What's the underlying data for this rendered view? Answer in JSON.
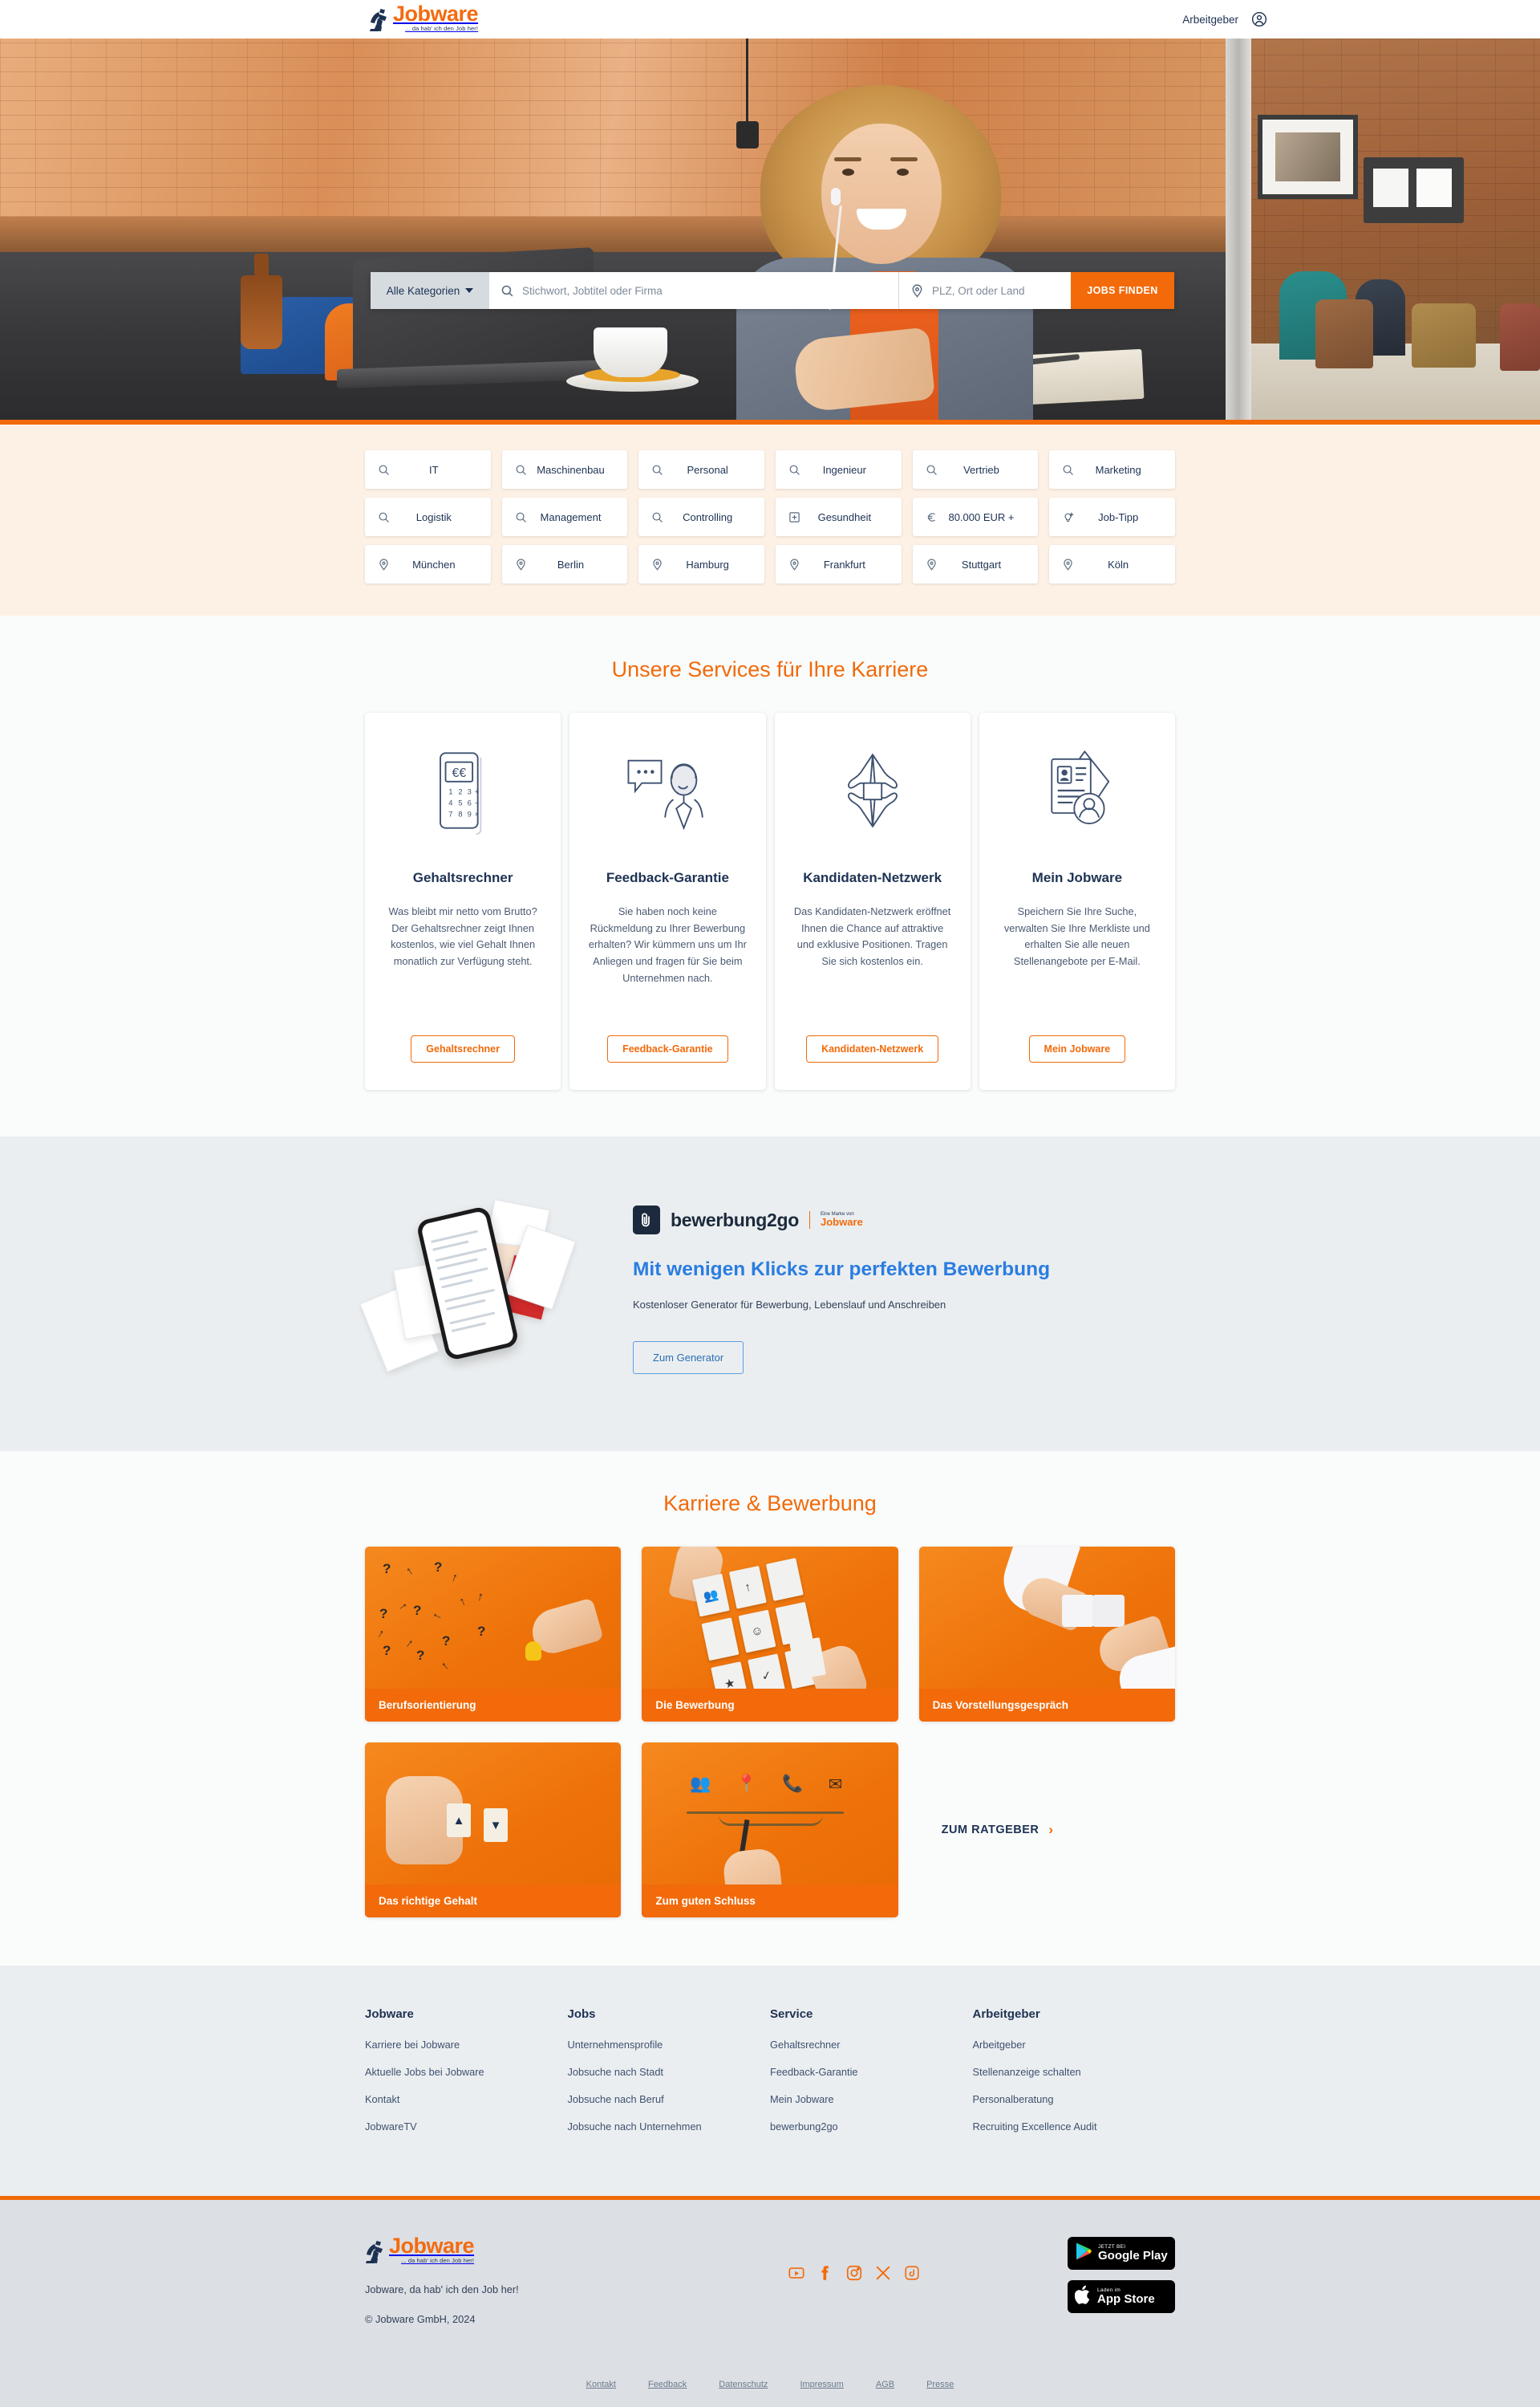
{
  "header": {
    "brand_name": "Jobware",
    "brand_tagline": "... da hab' ich den Job her!",
    "employer_link": "Arbeitgeber",
    "account_icon": "user-account-icon"
  },
  "search": {
    "category_label": "Alle Kategorien",
    "keyword_placeholder": "Stichwort, Jobtitel oder Firma",
    "keyword_value": "",
    "location_placeholder": "PLZ, Ort oder Land",
    "location_value": "",
    "submit_label": "JOBS FINDEN"
  },
  "chips": [
    {
      "label": "IT",
      "icon": "search-icon"
    },
    {
      "label": "Maschinenbau",
      "icon": "search-icon"
    },
    {
      "label": "Personal",
      "icon": "search-icon"
    },
    {
      "label": "Ingenieur",
      "icon": "search-icon"
    },
    {
      "label": "Vertrieb",
      "icon": "search-icon"
    },
    {
      "label": "Marketing",
      "icon": "search-icon"
    },
    {
      "label": "Logistik",
      "icon": "search-icon"
    },
    {
      "label": "Management",
      "icon": "search-icon"
    },
    {
      "label": "Controlling",
      "icon": "search-icon"
    },
    {
      "label": "Gesundheit",
      "icon": "health-cross-icon"
    },
    {
      "label": "80.000 EUR +",
      "icon": "euro-icon"
    },
    {
      "label": "Job-Tipp",
      "icon": "lightbulb-icon"
    },
    {
      "label": "München",
      "icon": "location-pin-icon"
    },
    {
      "label": "Berlin",
      "icon": "location-pin-icon"
    },
    {
      "label": "Hamburg",
      "icon": "location-pin-icon"
    },
    {
      "label": "Frankfurt",
      "icon": "location-pin-icon"
    },
    {
      "label": "Stuttgart",
      "icon": "location-pin-icon"
    },
    {
      "label": "Köln",
      "icon": "location-pin-icon"
    }
  ],
  "services": {
    "title": "Unsere Services für Ihre Karriere",
    "cards": [
      {
        "icon": "calculator-icon",
        "heading": "Gehaltsrechner",
        "text": "Was bleibt mir netto vom Brutto? Der Gehaltsrechner zeigt Ihnen kostenlos, wie viel Gehalt Ihnen monatlich zur Verfügung steht.",
        "button": "Gehaltsrechner"
      },
      {
        "icon": "speech-bubble-person-icon",
        "heading": "Feedback-Garantie",
        "text": "Sie haben noch keine Rückmeldung zu Ihrer Bewerbung erhalten? Wir kümmern uns um Ihr Anliegen und fragen für Sie beim Unternehmen nach.",
        "button": "Feedback-Garantie"
      },
      {
        "icon": "linked-hands-icon",
        "heading": "Kandidaten-Netzwerk",
        "text": "Das Kandidaten-Netzwerk eröffnet Ihnen die Chance auf attraktive und exklusive Positionen. Tragen Sie sich kostenlos ein.",
        "button": "Kandidaten-Netzwerk"
      },
      {
        "icon": "profile-document-icon",
        "heading": "Mein Jobware",
        "text": "Speichern Sie Ihre Suche, verwalten Sie Ihre Merkliste und erhalten Sie alle neuen Stellenangebote per E-Mail.",
        "button": "Mein Jobware"
      }
    ]
  },
  "bewerbung2go": {
    "logo_name": "bewerbung2go",
    "logo_sub_top": "Eine Marke von",
    "logo_sub_brand": "Jobware",
    "headline": "Mit wenigen Klicks zur perfekten Bewerbung",
    "subline": "Kostenloser Generator für Bewerbung, Lebenslauf und Anschreiben",
    "button": "Zum Generator"
  },
  "ratgeber": {
    "title": "Karriere & Bewerbung",
    "tiles": [
      {
        "caption": "Berufsorientierung"
      },
      {
        "caption": "Die Bewerbung"
      },
      {
        "caption": "Das Vorstellungsgespräch"
      },
      {
        "caption": "Das richtige Gehalt"
      },
      {
        "caption": "Zum guten Schluss"
      }
    ],
    "cta_label": "ZUM RATGEBER",
    "cta_arrow": "›"
  },
  "footer_columns": [
    {
      "heading": "Jobware",
      "links": [
        "Karriere bei Jobware",
        "Aktuelle Jobs bei Jobware",
        "Kontakt",
        "JobwareTV"
      ]
    },
    {
      "heading": "Jobs",
      "links": [
        "Unternehmensprofile",
        "Jobsuche nach Stadt",
        "Jobsuche nach Beruf",
        "Jobsuche nach Unternehmen"
      ]
    },
    {
      "heading": "Service",
      "links": [
        "Gehaltsrechner",
        "Feedback-Garantie",
        "Mein Jobware",
        "bewerbung2go"
      ]
    },
    {
      "heading": "Arbeitgeber",
      "links": [
        "Arbeitgeber",
        "Stellenanzeige schalten",
        "Personalberatung",
        "Recruiting Excellence Audit"
      ]
    }
  ],
  "bottom": {
    "brand_name": "Jobware",
    "brand_tagline": "... da hab' ich den Job her!",
    "claim": "Jobware, da hab' ich den Job her!",
    "copyright": "© Jobware GmbH, 2024",
    "socials": [
      {
        "name": "youtube-icon"
      },
      {
        "name": "facebook-icon"
      },
      {
        "name": "instagram-icon"
      },
      {
        "name": "x-twitter-icon"
      },
      {
        "name": "tiktok-icon"
      }
    ],
    "stores": [
      {
        "top": "JETZT BEI",
        "name": "Google Play",
        "icon": "google-play-icon"
      },
      {
        "top": "Laden im",
        "name": "App Store",
        "icon": "apple-icon"
      }
    ],
    "legal": [
      "Kontakt",
      "Feedback",
      "Datenschutz",
      "Impressum",
      "AGB",
      "Presse"
    ]
  },
  "colors": {
    "accent_orange": "#f26a0a",
    "navy": "#1d3253",
    "blue": "#2a7de1",
    "cream": "#fdf1e5",
    "grey": "#ebeef0"
  }
}
